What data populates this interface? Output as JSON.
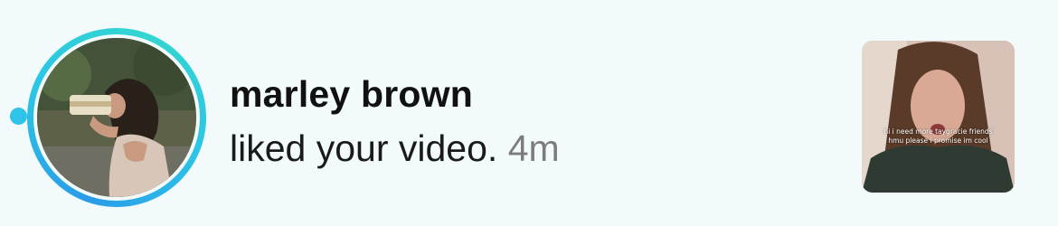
{
  "notification": {
    "username": "marley brown",
    "action": "liked your video.",
    "time": "4m",
    "unread": true,
    "avatar_icon": "user-avatar-photo",
    "ring_colors": [
      "#2a9be8",
      "#33d6d0"
    ],
    "accent": "#2fc3ea",
    "video_thumbnail": {
      "caption": "hi i need more taygracie friends hmu please i promise im cool"
    }
  }
}
